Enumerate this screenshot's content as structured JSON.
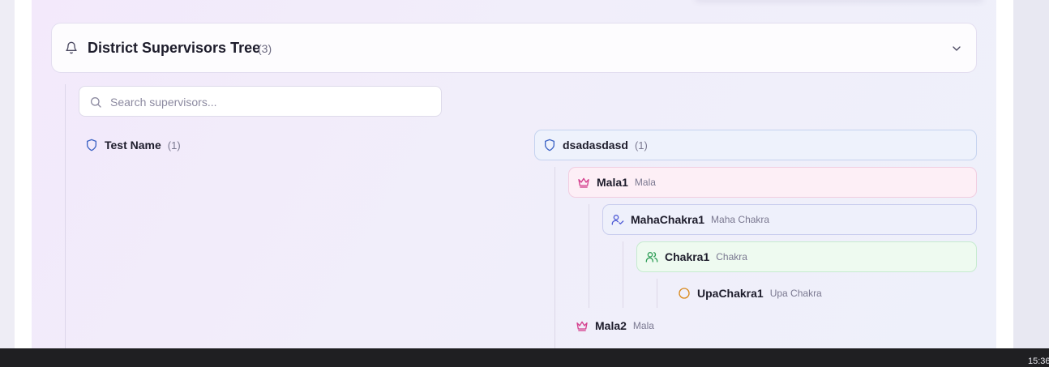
{
  "section": {
    "title": "District Supervisors Tree",
    "count": "(3)"
  },
  "search": {
    "placeholder": "Search supervisors...",
    "value": ""
  },
  "left_tree": {
    "name": "Test Name",
    "count": "(1)"
  },
  "right_tree": {
    "root": {
      "name": "dsadasdasd",
      "count": "(1)"
    },
    "nodes": [
      {
        "name": "Mala1",
        "role": "Mala",
        "icon": "crown-icon",
        "color": "#d43f8d"
      },
      {
        "name": "MahaChakra1",
        "role": "Maha Chakra",
        "icon": "user-check-icon",
        "color": "#4f5bd5"
      },
      {
        "name": "Chakra1",
        "role": "Chakra",
        "icon": "users-icon",
        "color": "#2f9e57"
      },
      {
        "name": "UpaChakra1",
        "role": "Upa Chakra",
        "icon": "circle-icon",
        "color": "#d9881a"
      },
      {
        "name": "Mala2",
        "role": "Mala",
        "icon": "crown-icon",
        "color": "#d43f8d"
      }
    ]
  },
  "taskbar": {
    "clock": "15:36"
  },
  "colors": {
    "shield": "#3b62c4",
    "accent": "#6c6a80"
  }
}
